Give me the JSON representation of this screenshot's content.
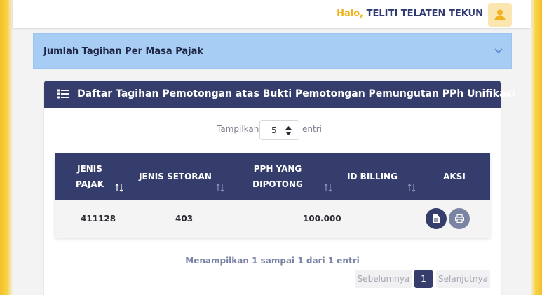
{
  "header": {
    "greeting": "Halo,",
    "user_name": "TELITI TELATEN TEKUN",
    "avatar_icon": "user-icon"
  },
  "accordion": {
    "title": "Jumlah Tagihan Per Masa Pajak",
    "icon": "chevron-down-icon"
  },
  "card": {
    "title": "Daftar Tagihan Pemotongan atas Bukti Pemotongan Pemungutan PPh Unifikasi",
    "icon": "list-icon"
  },
  "length": {
    "label": "Tampilkan",
    "value": "5",
    "suffix": "entri"
  },
  "table": {
    "columns": [
      "JENIS PAJAK",
      "JENIS SETORAN",
      "PPH YANG DIPOTONG",
      "ID BILLING",
      "AKSI"
    ],
    "rows": [
      {
        "jenis_pajak": "411128",
        "jenis_setoran": "403",
        "pph_dipotong": "100.000",
        "id_billing": ""
      }
    ]
  },
  "info": "Menampilkan 1 sampai 1 dari 1 entri",
  "pagination": {
    "prev": "Sebelumnya",
    "page": "1",
    "next": "Selanjutnya"
  },
  "colors": {
    "primary": "#343d6b",
    "accent": "#f2b21c",
    "accordion_bg": "#a8cdf5"
  }
}
